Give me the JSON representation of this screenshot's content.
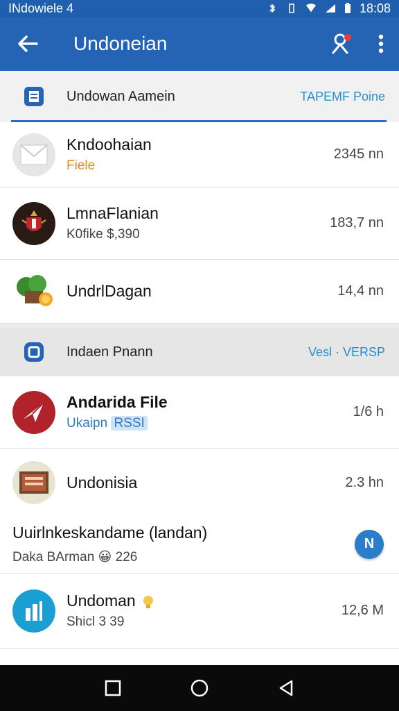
{
  "status_bar": {
    "carrier": "INdowiele 4",
    "time": "18:08"
  },
  "app_bar": {
    "title": "Undoneian"
  },
  "sections": [
    {
      "title": "Undowan Aamein",
      "action": "TAPEMF Poine",
      "rows": [
        {
          "title": "Kndoohaian",
          "subtitle": "Fiele",
          "meta": "2345 nn"
        },
        {
          "title": "LmnaFlanian",
          "subtitle": "K0fike $,390",
          "meta": "183,7 nn"
        },
        {
          "title": "UndrlDagan",
          "subtitle": "",
          "meta": "14,4 nn"
        }
      ]
    },
    {
      "title": "Indaen Pnann",
      "action": "Vesl · VERSP",
      "rows": [
        {
          "title": "Andarida File",
          "subtitle": "Ukaipn",
          "badge": "RSSI",
          "meta": "1/6 h"
        },
        {
          "title": "Undonisia",
          "subtitle": "",
          "meta": "2.3 hn"
        },
        {
          "title": "Uuirlnkeskandame (landan)",
          "subtitle": "Daka BArman 😀 226",
          "meta": ""
        },
        {
          "title": "Undoman",
          "subtitle": "Shicl 3 39",
          "meta": "12,6 M"
        }
      ]
    }
  ],
  "fab_label": "N",
  "colors": {
    "primary": "#2564b5",
    "accent": "#2a8dcc",
    "orange": "#e8891d"
  }
}
